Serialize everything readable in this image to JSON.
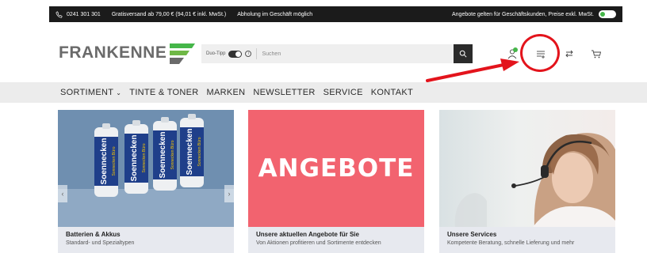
{
  "topbar": {
    "phone": "0241 301 301",
    "shipping": "Gratisversand ab 79,00 € (94,01 € inkl. MwSt.)",
    "pickup": "Abholung im Geschäft möglich",
    "business_note": "Angebote gelten für Geschäftskunden, Preise exkl. MwSt."
  },
  "header": {
    "logo_text": "FRANKENNE",
    "duo_label": "Duo-Tipp",
    "search_placeholder": "Suchen"
  },
  "nav": {
    "items": [
      "SORTIMENT",
      "TINTE & TONER",
      "MARKEN",
      "NEWSLETTER",
      "SERVICE",
      "KONTAKT"
    ]
  },
  "cards": [
    {
      "title": "Batterien & Akkus",
      "subtitle": "Standard- und Spezialtypen",
      "battery_brand": "Soennecken",
      "battery_slogan": "Sonnecken Büro",
      "battery_type": "LR6 | AA | Mignon"
    },
    {
      "title": "Unsere aktuellen Angebote für Sie",
      "subtitle": "Von Aktionen profitieren und Sortimente entdecken",
      "banner_text": "ANGEBOTE"
    },
    {
      "title": "Unsere Services",
      "subtitle": "Kompetente Beratung, schnelle Lieferung und mehr"
    }
  ],
  "colors": {
    "brand_green": "#45b649",
    "offer_red": "#f2636f",
    "highlight_red": "#e3141c",
    "topbar": "#1b1b1b"
  }
}
